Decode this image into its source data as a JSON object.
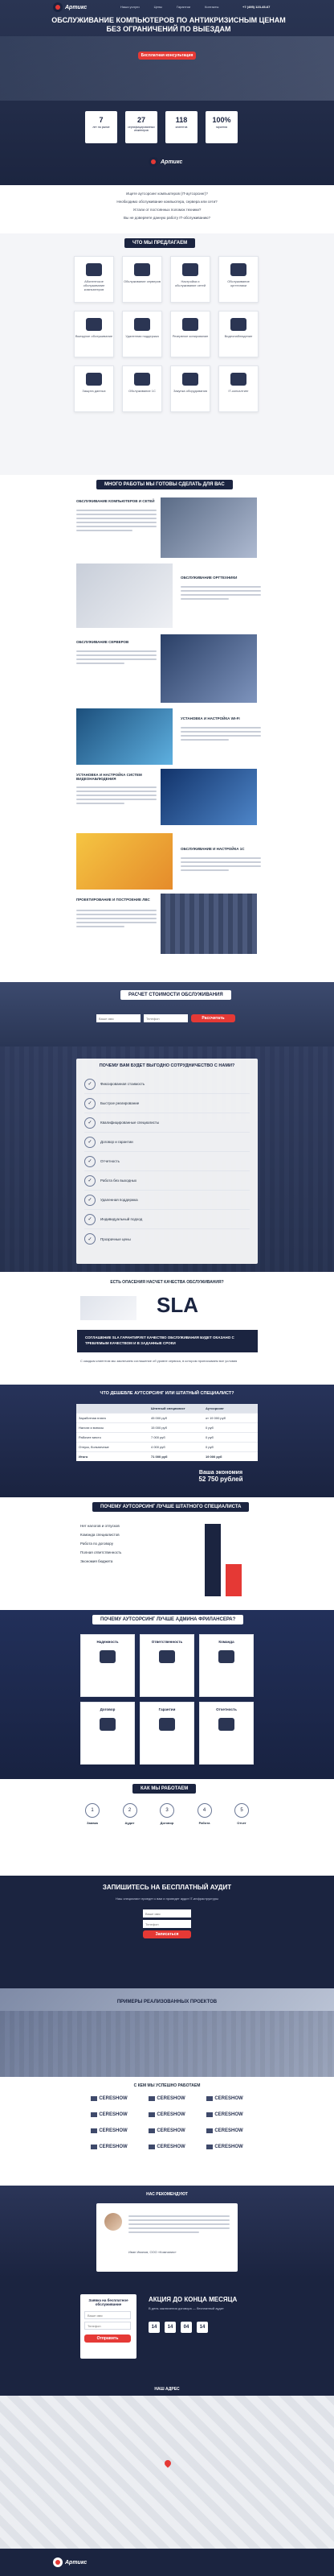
{
  "header": {
    "logo": "Артикс",
    "nav": [
      "Наши услуги",
      "Цены",
      "Гарантии",
      "Контакты"
    ],
    "phone": "+7 (495) 123-45-67"
  },
  "hero": {
    "title": "Обслуживание компьютеров по антикризисным ценам без ограничений по выездам",
    "cta": "Бесплатная консультация",
    "stats": [
      {
        "value": "7",
        "label": "лет на рынке"
      },
      {
        "value": "27",
        "label": "сертифицированных инженеров"
      },
      {
        "value": "118",
        "label": "клиентов"
      },
      {
        "value": "100%",
        "label": "гарантия"
      }
    ],
    "questions": [
      "Ищете аутсорсинг компьютеров (IT-аутсорсинг)?",
      "Необходимо обслуживание компьютера, сервера или сети?",
      "Устали от постоянных поломок техники?",
      "Вы не доверяете данную работу IT-обслуживанию?"
    ]
  },
  "offer": {
    "title": "Что мы предлагаем",
    "cards": [
      "Абонентское обслуживание компьютеров",
      "Обслуживание серверов",
      "Настройка и обслуживание сетей",
      "Обслуживание оргтехники",
      "Выездное обслуживание",
      "Удаленная поддержка",
      "Резервное копирование",
      "Видеонаблюдение",
      "Защита данных",
      "Обслуживание 1С",
      "Закупка оборудования",
      "IT-консалтинг"
    ]
  },
  "works": {
    "title": "Много работы мы готовы сделать для вас",
    "items": [
      "Обслуживание компьютеров и сетей",
      "Обслуживание оргтехники",
      "Обслуживание серверов",
      "Установка и настройка Wi-Fi",
      "Установка и настройка систем видеонаблюдения",
      "Обслуживание и настройка 1С",
      "Проектирование и построение ЛВС"
    ]
  },
  "calc": {
    "title": "Расчет стоимости обслуживания",
    "placeholder_name": "Ваше имя",
    "placeholder_phone": "Телефон",
    "button": "Рассчитать"
  },
  "why": {
    "title": "Почему вам будет выгодно сотрудничество с нами?",
    "rows": [
      "Фиксированная стоимость",
      "Быстрое реагирование",
      "Квалифицированные специалисты",
      "Договор и гарантии",
      "Отчетность",
      "Работа без выходных",
      "Удаленная поддержка",
      "Индивидуальный подход",
      "Прозрачные цены"
    ]
  },
  "sla": {
    "question": "Есть опасения насчет качества обслуживания?",
    "heading": "SLA",
    "body": "Соглашение SLA гарантирует качество обслуживания будет оказано с требуемым качеством и в заданные сроки",
    "note": "С каждым клиентом мы заключаем соглашение об уровне сервиса, в котором прописываем все условия"
  },
  "compare": {
    "title": "Что дешевле аутсорсинг или штатный специалист?",
    "cols": [
      "Штатный специалист",
      "Аутсорсинг"
    ],
    "rows": [
      [
        "Заработная плата",
        "45 000 руб",
        "от 19 000 руб"
      ],
      [
        "Налоги и взносы",
        "15 000 руб",
        "0 руб"
      ],
      [
        "Рабочее место",
        "7 000 руб",
        "0 руб"
      ],
      [
        "Отпуск, больничные",
        "4 000 руб",
        "0 руб"
      ],
      [
        "Итого",
        "71 000 руб",
        "19 000 руб"
      ]
    ],
    "saving_label": "Ваша экономия",
    "saving_value": "52 750 рублей"
  },
  "better": {
    "title": "Почему аутсорсинг лучше штатного специалиста",
    "points": [
      "Нет налогов и отпусков",
      "Команда специалистов",
      "Работа по договору",
      "Полная ответственность",
      "Экономия бюджета"
    ]
  },
  "freelance": {
    "title": "Почему аутсорсинг лучше админа фрилансера?",
    "cards": [
      "Надежность",
      "Ответственность",
      "Команда",
      "Договор",
      "Гарантии",
      "Отчетность"
    ]
  },
  "how": {
    "title": "Как мы работаем",
    "steps": [
      "Заявка",
      "Аудит",
      "Договор",
      "Работа",
      "Отчет"
    ]
  },
  "audit": {
    "title": "Запишитесь на бесплатный аудит",
    "sub": "Наш специалист приедет к вам и проведет аудит IT-инфраструктуры",
    "placeholder_name": "Ваше имя",
    "placeholder_phone": "Телефон",
    "button": "Записаться"
  },
  "projects": {
    "title": "Примеры реализованных проектов"
  },
  "clients": {
    "title": "С кем мы успешно работаем",
    "logo": "CERESHOW"
  },
  "recommend": {
    "title": "Нас рекомендуют",
    "author": "Иван Иванов, ООО «Компания»"
  },
  "promo": {
    "left_title": "Заявка на бесплатное обслуживание",
    "button": "Отправить",
    "action": "Акция до конца месяца",
    "action_sub": "В день заключения договора — бесплатный аудит",
    "timer": [
      "14",
      "14",
      "04",
      "14"
    ]
  },
  "footer": {
    "title": "Наш адрес",
    "logo": "Артикс"
  },
  "colors": {
    "accent": "#e53935",
    "navy": "#1b2440"
  }
}
